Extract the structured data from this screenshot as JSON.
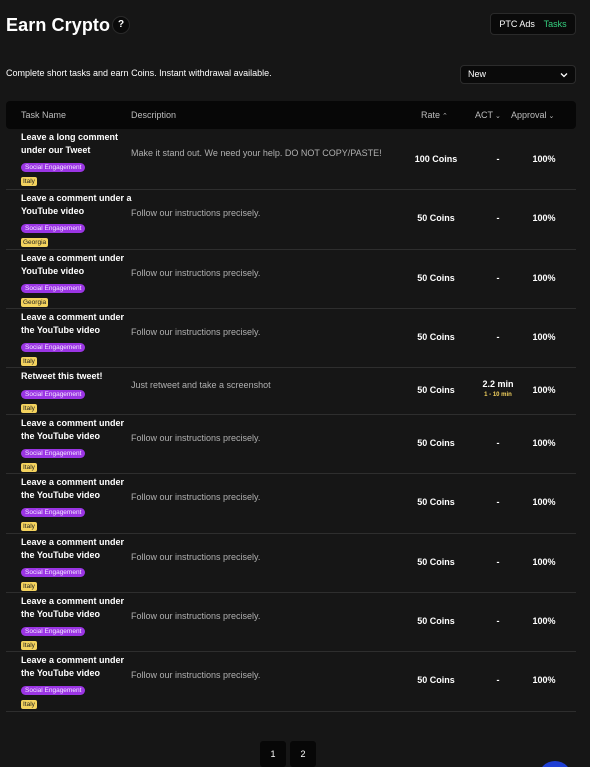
{
  "header": {
    "title": "Earn Crypto",
    "help_label": "?",
    "tabs": [
      {
        "label": "PTC Ads",
        "active": false
      },
      {
        "label": "Tasks",
        "active": true
      }
    ]
  },
  "subtitle": "Complete short tasks and earn Coins. Instant withdrawal available.",
  "sort": {
    "selected": "New"
  },
  "table": {
    "columns": {
      "name": "Task Name",
      "description": "Description",
      "rate": "Rate",
      "act": "ACT",
      "approval": "Approval"
    },
    "rows": [
      {
        "name": "Leave a long comment under our Tweet",
        "category": "Social Engagement",
        "country": "Italy",
        "description": "Make it stand out. We need your help. DO NOT COPY/PASTE!",
        "rate": "100 Coins",
        "act": "-",
        "act_range": "",
        "approval": "100%"
      },
      {
        "name": "Leave a comment under a YouTube video",
        "category": "Social Engagement",
        "country": "Georgia",
        "description": "Follow our instructions precisely.",
        "rate": "50 Coins",
        "act": "-",
        "act_range": "",
        "approval": "100%"
      },
      {
        "name": "Leave a comment under YouTube video",
        "category": "Social Engagement",
        "country": "Georgia",
        "description": "Follow our instructions precisely.",
        "rate": "50 Coins",
        "act": "-",
        "act_range": "",
        "approval": "100%"
      },
      {
        "name": "Leave a comment under the YouTube video",
        "category": "Social Engagement",
        "country": "Italy",
        "description": "Follow our instructions precisely.",
        "rate": "50 Coins",
        "act": "-",
        "act_range": "",
        "approval": "100%"
      },
      {
        "name": "Retweet this tweet!",
        "category": "Social Engagement",
        "country": "Italy",
        "description": "Just retweet and take a screenshot",
        "rate": "50 Coins",
        "act": "2.2 min",
        "act_range": "1 - 10 min",
        "approval": "100%"
      },
      {
        "name": "Leave a comment under the YouTube video",
        "category": "Social Engagement",
        "country": "Italy",
        "description": "Follow our instructions precisely.",
        "rate": "50 Coins",
        "act": "-",
        "act_range": "",
        "approval": "100%"
      },
      {
        "name": "Leave a comment under the YouTube video",
        "category": "Social Engagement",
        "country": "Italy",
        "description": "Follow our instructions precisely.",
        "rate": "50 Coins",
        "act": "-",
        "act_range": "",
        "approval": "100%"
      },
      {
        "name": "Leave a comment under the YouTube video",
        "category": "Social Engagement",
        "country": "Italy",
        "description": "Follow our instructions precisely.",
        "rate": "50 Coins",
        "act": "-",
        "act_range": "",
        "approval": "100%"
      },
      {
        "name": "Leave a comment under the YouTube video",
        "category": "Social Engagement",
        "country": "Italy",
        "description": "Follow our instructions precisely.",
        "rate": "50 Coins",
        "act": "-",
        "act_range": "",
        "approval": "100%"
      },
      {
        "name": "Leave a comment under the YouTube video",
        "category": "Social Engagement",
        "country": "Italy",
        "description": "Follow our instructions precisely.",
        "rate": "50 Coins",
        "act": "-",
        "act_range": "",
        "approval": "100%"
      }
    ]
  },
  "pagination": {
    "pages": [
      "1",
      "2"
    ]
  },
  "icons": {
    "help": "help-icon",
    "dropdown": "chevron-down-icon",
    "sort": "caret-icon",
    "fab": "chat-bubble-icon"
  },
  "colors": {
    "tab_active": "#35d07f",
    "category_badge": "#9b35e4",
    "country_badge": "#f4d35e",
    "fab": "#1f3fd4"
  }
}
